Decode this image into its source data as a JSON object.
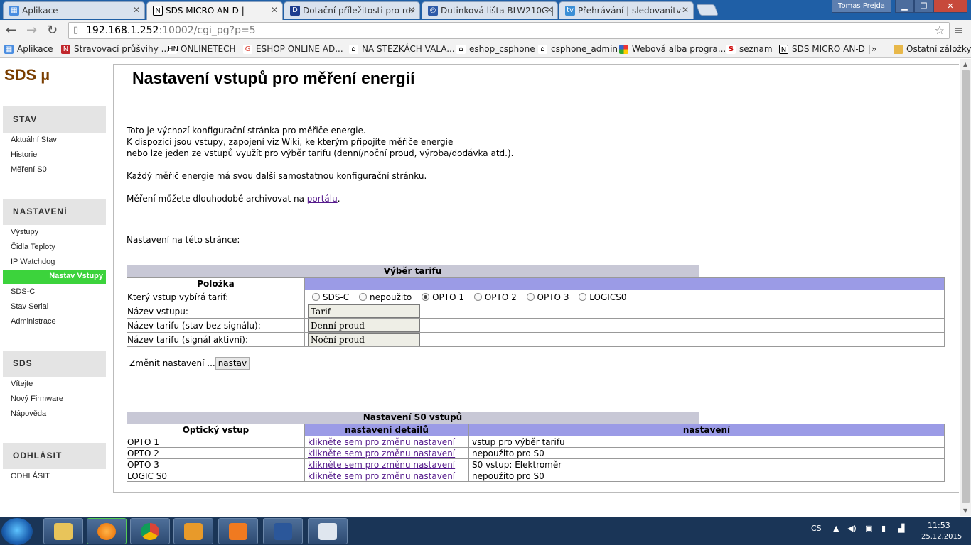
{
  "browser": {
    "tabs": [
      {
        "title": "Aplikace",
        "icon": "apps-icon"
      },
      {
        "title": "SDS MICRO AN-D |",
        "icon": "sds-icon"
      },
      {
        "title": "Dotační příležitosti pro roz",
        "icon": "doc-icon"
      },
      {
        "title": "Dutinková lišta BLW210G |",
        "icon": "globe-icon"
      },
      {
        "title": "Přehrávání | sledovanitv",
        "icon": "tv-icon"
      }
    ],
    "profile_name": "Tomas Prejda",
    "url_host": "192.168.1.252",
    "url_rest": ":10002/cgi_pg?p=5",
    "bookmarks": [
      "Aplikace",
      "Stravovací průšvihy ...",
      "ONLINETECH",
      "ESHOP ONLINE AD...",
      "NA STEZKÁCH VALA...",
      "eshop_csphone",
      "csphone_admin",
      "Webová alba progra...",
      "seznam",
      "SDS MICRO AN-D |"
    ],
    "bookmarks_more": "»",
    "other_bookmarks": "Ostatní záložky"
  },
  "sidebar": {
    "logo": "SDS µ",
    "sections": [
      {
        "title": "STAV",
        "items": [
          "Aktuální Stav",
          "Historie",
          "Měření S0"
        ]
      },
      {
        "title": "NASTAVENÍ",
        "items": [
          "Výstupy",
          "Čidla Teploty",
          "IP Watchdog",
          "Nastav Vstupy",
          "SDS-C",
          "Stav Serial",
          "Administrace"
        ]
      },
      {
        "title": "SDS",
        "items": [
          "Vítejte",
          "Nový Firmware",
          "Nápověda"
        ]
      },
      {
        "title": "ODHLÁSIT",
        "items": [
          "ODHLÁSIT"
        ]
      }
    ],
    "active_item": "Nastav Vstupy"
  },
  "page": {
    "title": "Nastavení vstupů pro měření energií",
    "intro_lines": [
      "Toto je výchozí konfigurační stránka pro měřiče energie.",
      "K dispozici jsou vstupy, zapojení viz Wiki, ke kterým připojíte měřiče energie",
      "nebo lze jeden ze vstupů využít pro výběr tarifu (denní/noční proud, výroba/dodávka atd.)."
    ],
    "intro2": "Každý měřič energie má svou další samostatnou konfigurační stránku.",
    "archive_prefix": "Měření můžete dlouhodobě archivovat na ",
    "archive_link": "portálu",
    "archive_suffix": ".",
    "settings_label": "Nastavení na této stránce:"
  },
  "tariff": {
    "caption": "Výběr tarifu",
    "header_item": "Položka",
    "rows": {
      "input_label": "Který vstup vybírá tarif:",
      "name_label": "Název vstupu:",
      "tariff_off_label": "Název tarifu (stav bez signálu):",
      "tariff_on_label": "Název tarifu (signál aktivní):"
    },
    "options": [
      "SDS-C",
      "nepoužito",
      "OPTO 1",
      "OPTO 2",
      "OPTO 3",
      "LOGICS0"
    ],
    "selected": "OPTO 1",
    "name_value": "Tarif",
    "tariff_off_value": "Denní proud",
    "tariff_on_value": "Noční proud",
    "change_label": "Změnit nastavení ...",
    "submit": "nastav"
  },
  "s0": {
    "caption": "Nastavení S0 vstupů",
    "headers": [
      "Optický vstup",
      "nastavení detailů",
      "nastavení"
    ],
    "rows": [
      {
        "input": "OPTO 1",
        "link": "klikněte sem pro změnu nastavení",
        "setting": "vstup pro výběr tarifu"
      },
      {
        "input": "OPTO 2",
        "link": "klikněte sem pro změnu nastavení",
        "setting": "nepoužito pro S0"
      },
      {
        "input": "OPTO 3",
        "link": "klikněte sem pro změnu nastavení",
        "setting": "S0 vstup: Elektroměr"
      },
      {
        "input": "LOGIC S0",
        "link": "klikněte sem pro změnu nastavení",
        "setting": "nepoužito pro S0"
      }
    ]
  },
  "taskbar": {
    "lang": "CS",
    "time": "11:53",
    "date": "25.12.2015"
  }
}
